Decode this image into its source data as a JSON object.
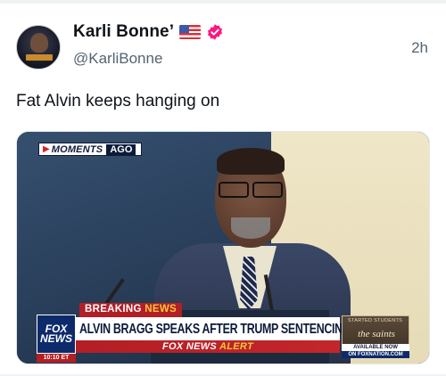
{
  "post": {
    "author": {
      "display_name": "Karli Bonne’",
      "handle": "@KarliBonne",
      "flag_icon": "us-flag-icon",
      "verified_icon": "verified-badge-icon",
      "verified_color": "#f91880"
    },
    "timestamp": "2h",
    "text": "Fat Alvin keeps hanging on"
  },
  "media": {
    "moments_word": "MOMENTS",
    "moments_ago": "AGO",
    "breaking_word": "BREAKING",
    "breaking_news": "NEWS",
    "headline": "ALVIN BRAGG SPEAKS AFTER TRUMP SENTENCING DELAY",
    "alert_prefix": "FOX NEWS",
    "alert_word": "ALERT",
    "logo_line1": "FOX",
    "logo_line2": "NEWS",
    "clock": "10:10 ET",
    "ad_small": "STARTED STUDENTS",
    "ad_title": "the saints",
    "ad_available": "AVAILABLE NOW",
    "ad_on": "ON FOXNATION.COM"
  },
  "colors": {
    "fox_red": "#b21f24",
    "fox_navy": "#0d1b3a",
    "alert_yellow": "#f4c73a"
  }
}
